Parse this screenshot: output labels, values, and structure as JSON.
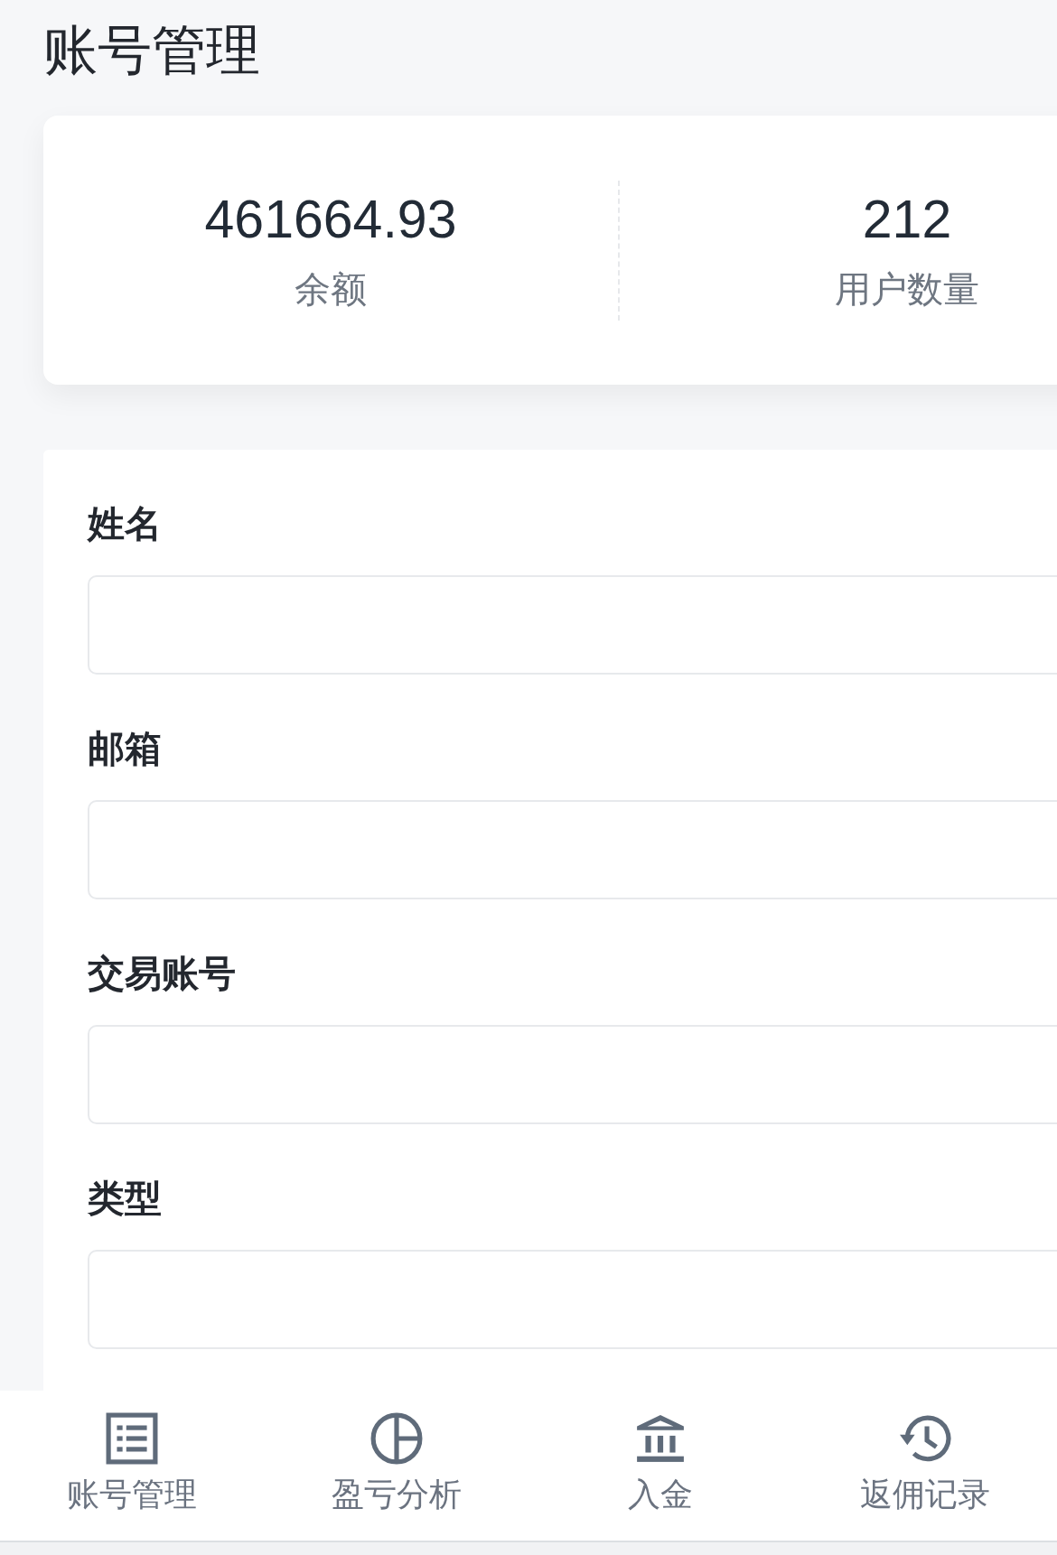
{
  "page": {
    "title": "账号管理"
  },
  "stats": [
    {
      "value": "461664.93",
      "label": "余额"
    },
    {
      "value": "212",
      "label": "用户数量"
    }
  ],
  "form": {
    "fields": [
      {
        "label": "姓名"
      },
      {
        "label": "邮箱"
      },
      {
        "label": "交易账号"
      },
      {
        "label": "类型"
      }
    ]
  },
  "tab_bar": {
    "tabs": [
      {
        "label": "账号管理",
        "kind": "list"
      },
      {
        "label": "盈亏分析",
        "kind": "pie"
      },
      {
        "label": "入金",
        "kind": "bank"
      },
      {
        "label": "返佣记录",
        "kind": "history"
      }
    ]
  }
}
